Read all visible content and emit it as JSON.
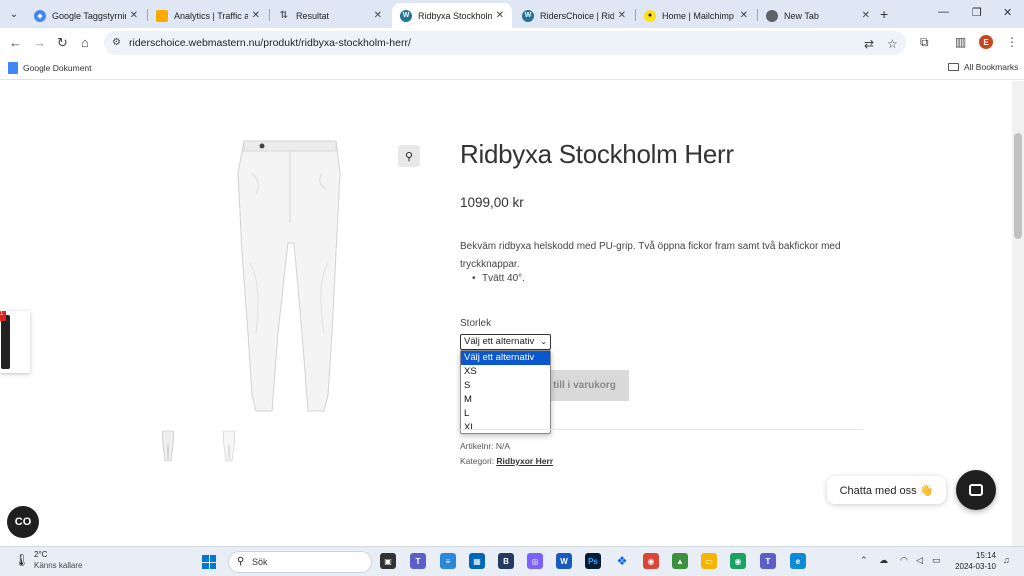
{
  "tabs": [
    {
      "title": "Google Taggstyrning",
      "active": false,
      "favicon_color": "#4285f4"
    },
    {
      "title": "Analytics | Traffic acq",
      "active": false,
      "favicon_color": "#f9ab00"
    },
    {
      "title": "Resultat",
      "active": false,
      "favicon_color": "#5f6368"
    },
    {
      "title": "Ridbyxa Stockholm H",
      "active": true,
      "favicon_color": "#21759b"
    },
    {
      "title": "RidersChoice | Rider",
      "active": false,
      "favicon_color": "#21759b"
    },
    {
      "title": "Home | Mailchimp",
      "active": false,
      "favicon_color": "#ffe01b"
    },
    {
      "title": "New Tab",
      "active": false,
      "favicon_color": "#5f6368"
    }
  ],
  "address_bar": {
    "url": "riderschoice.webmastern.nu/produkt/ridbyxa-stockholm-herr/"
  },
  "profile_initial": "E",
  "bookmarks": {
    "left": "Google Dokument",
    "right": "All Bookmarks"
  },
  "product": {
    "title": "Ridbyxa Stockholm Herr",
    "price": "1099,00 kr",
    "description": "Bekväm ridbyxa helskodd med PU-grip. Två öppna fickor fram samt två bakfickor med tryckknappar.",
    "bullet": "Tvätt 40°.",
    "size_label": "Storlek",
    "select_value": "Välj ett alternativ",
    "options": [
      "Välj ett alternativ",
      "XS",
      "S",
      "M",
      "L",
      "XL"
    ],
    "add_to_cart": "till i varukorg",
    "sku_label": "Artikelnr:",
    "sku": "N/A",
    "category_label": "Kategori:",
    "category": "Ridbyxor Herr"
  },
  "chat": {
    "bubble_text": "Chatta med oss 👋"
  },
  "side_badge": "1",
  "taskbar": {
    "temperature": "2°C",
    "weather_desc": "Känns kallare",
    "search_text": "Sök",
    "time": "15:14",
    "date": "2024-03-10"
  }
}
